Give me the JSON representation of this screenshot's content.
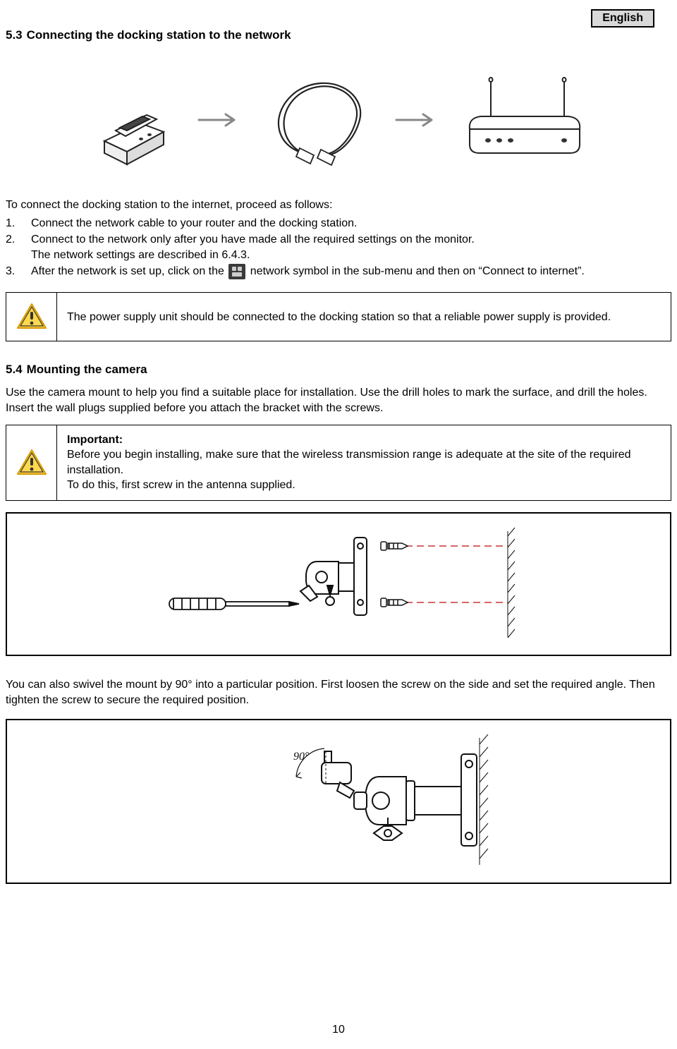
{
  "header": {
    "language": "English"
  },
  "section53": {
    "number": "5.3",
    "title": "Connecting the docking station to the network",
    "intro": "To connect the docking station to the internet, proceed as follows:",
    "step1_n": "1.",
    "step1": "Connect the network cable to your router and the docking station.",
    "step2_n": "2.",
    "step2_line1": "Connect to the network only after you have made all the required settings on the monitor.",
    "step2_line2": "The network settings are described in 6.4.3.",
    "step3_n": "3.",
    "step3_prefix": "After the network is set up, click on the ",
    "step3_suffix": " network symbol in the sub-menu and then on “Connect to internet”.",
    "warning": "The power supply unit should be connected to the docking station so that a reliable power supply is provided."
  },
  "section54": {
    "number": "5.4",
    "title": "Mounting the camera",
    "intro": "Use the camera mount to help you find a suitable place for installation. Use the drill holes to mark the surface, and drill the holes. Insert the wall plugs supplied before you attach the bracket with the screws.",
    "important_label": "Important:",
    "important_line1": "Before you begin installing, make sure that the wireless transmission range is adequate at the site of the required installation.",
    "important_line2": "To do this, first screw in the antenna supplied.",
    "swivel": "You can also swivel the mount by 90° into a particular position. First loosen the screw on the side and set the required angle. Then tighten the screw to secure the required position.",
    "angle_label": "90°"
  },
  "page_number": "10"
}
